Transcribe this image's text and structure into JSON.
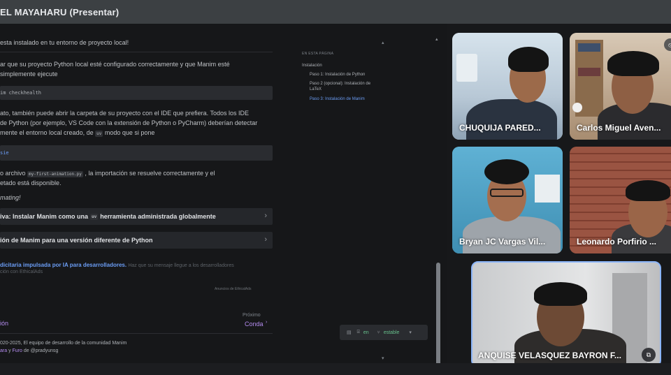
{
  "window": {
    "title": "EL MAYAHARU (Presentar)"
  },
  "doc": {
    "line_top": "esta instalado en tu entorno de proyecto local!",
    "para1_l1": "ar que su proyecto Python local esté configurado correctamente y que Manim esté",
    "para1_l2": "simplemente ejecute",
    "code1": "im checkhealth",
    "para2_l1": "ato, también puede abrir la carpeta de su proyecto con el IDE que prefiera. Todos los IDE",
    "para2_l2": "de Python (por ejemplo, VS Code con la extensión de Python o PyCharm) deberían detectar",
    "para2_l3_a": "mente el entorno local creado, de",
    "para2_l3_code": "uv",
    "para2_l3_b": "modo que si pone",
    "code2": "sie",
    "para3_l1_a": "o archivo",
    "para3_l1_code": "my-first-animation.py",
    "para3_l1_b": ", la importación se resuelve correctamente y el",
    "para3_l2": "etado está disponible.",
    "para4": "mating!",
    "collapse1_a": "iva: Instalar Manim como una",
    "collapse1_code": "uv",
    "collapse1_b": "herramienta administrada globalmente",
    "collapse2": "ión de Manim para una versión diferente de Python",
    "ad_link": "dicitaria impulsada por IA para desarrolladores.",
    "ad_text": "Haz que su mensaje llegue a los desarrolladores",
    "ad_text2": "ción con EthicalAds",
    "ad_small": "Anuncios de EthicalAds",
    "prev_label": "ión",
    "next_small": "Próximo",
    "next_label": "Conda",
    "footer_l1": "020-2025, El equipo de desarrollo de la comunidad Manim",
    "footer_l2_a": "ara",
    "footer_l2_b": " y ",
    "footer_l2_c": "Furo",
    "footer_l2_d": " de @pradyunsg"
  },
  "toc": {
    "header": "EN ESTA PÁGINA",
    "items": [
      "Instalación",
      "Paso 1: Instalación de Python",
      "Paso 2 (opcional): Instalación de",
      "LaTeX",
      "Paso 3: Instalación de Manim"
    ]
  },
  "langbar": {
    "lang": "en",
    "branch": "estable"
  },
  "participants": [
    {
      "name": "CHUQUIJA PARED..."
    },
    {
      "name": "Carlos Miguel Aven..."
    },
    {
      "name": "Bryan JC Vargas Vil..."
    },
    {
      "name": "Leonardo Porfirio ..."
    },
    {
      "name": "ANQUISE VELASQUEZ BAYRON F..."
    }
  ],
  "colors": {
    "accent_link": "#6b9df5",
    "branch_green": "#67c08c",
    "speaker_border": "#8ab4f8"
  }
}
